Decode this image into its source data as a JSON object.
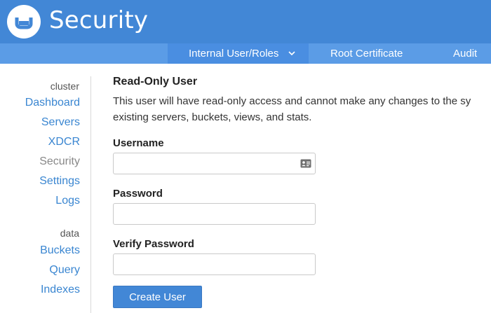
{
  "app": {
    "title": "Security"
  },
  "subnav": {
    "tabs": [
      {
        "label": "Internal User/Roles",
        "active": true
      },
      {
        "label": "Root Certificate"
      },
      {
        "label": "Audit"
      }
    ]
  },
  "sidebar": {
    "cluster_heading": "cluster",
    "cluster_items": [
      {
        "label": "Dashboard"
      },
      {
        "label": "Servers"
      },
      {
        "label": "XDCR"
      },
      {
        "label": "Security",
        "current": true
      },
      {
        "label": "Settings"
      },
      {
        "label": "Logs"
      }
    ],
    "data_heading": "data",
    "data_items": [
      {
        "label": "Buckets"
      },
      {
        "label": "Query"
      },
      {
        "label": "Indexes"
      }
    ]
  },
  "form": {
    "heading": "Read-Only User",
    "description_line1": "This user will have read-only access and cannot make any changes to the sy",
    "description_line2": "existing servers, buckets, views, and stats.",
    "username_label": "Username",
    "username_value": "",
    "password_label": "Password",
    "password_value": "",
    "verify_label": "Verify Password",
    "verify_value": "",
    "submit_label": "Create User"
  },
  "icons": {
    "logo": "couchbase-logo-icon",
    "dropdown": "chevron-down-icon",
    "autofill": "contact-card-icon"
  },
  "colors": {
    "header_bg": "#4287d6",
    "subnav_bg": "#5b9ce6",
    "link": "#3a86d1",
    "button_bg": "#4287d6"
  }
}
